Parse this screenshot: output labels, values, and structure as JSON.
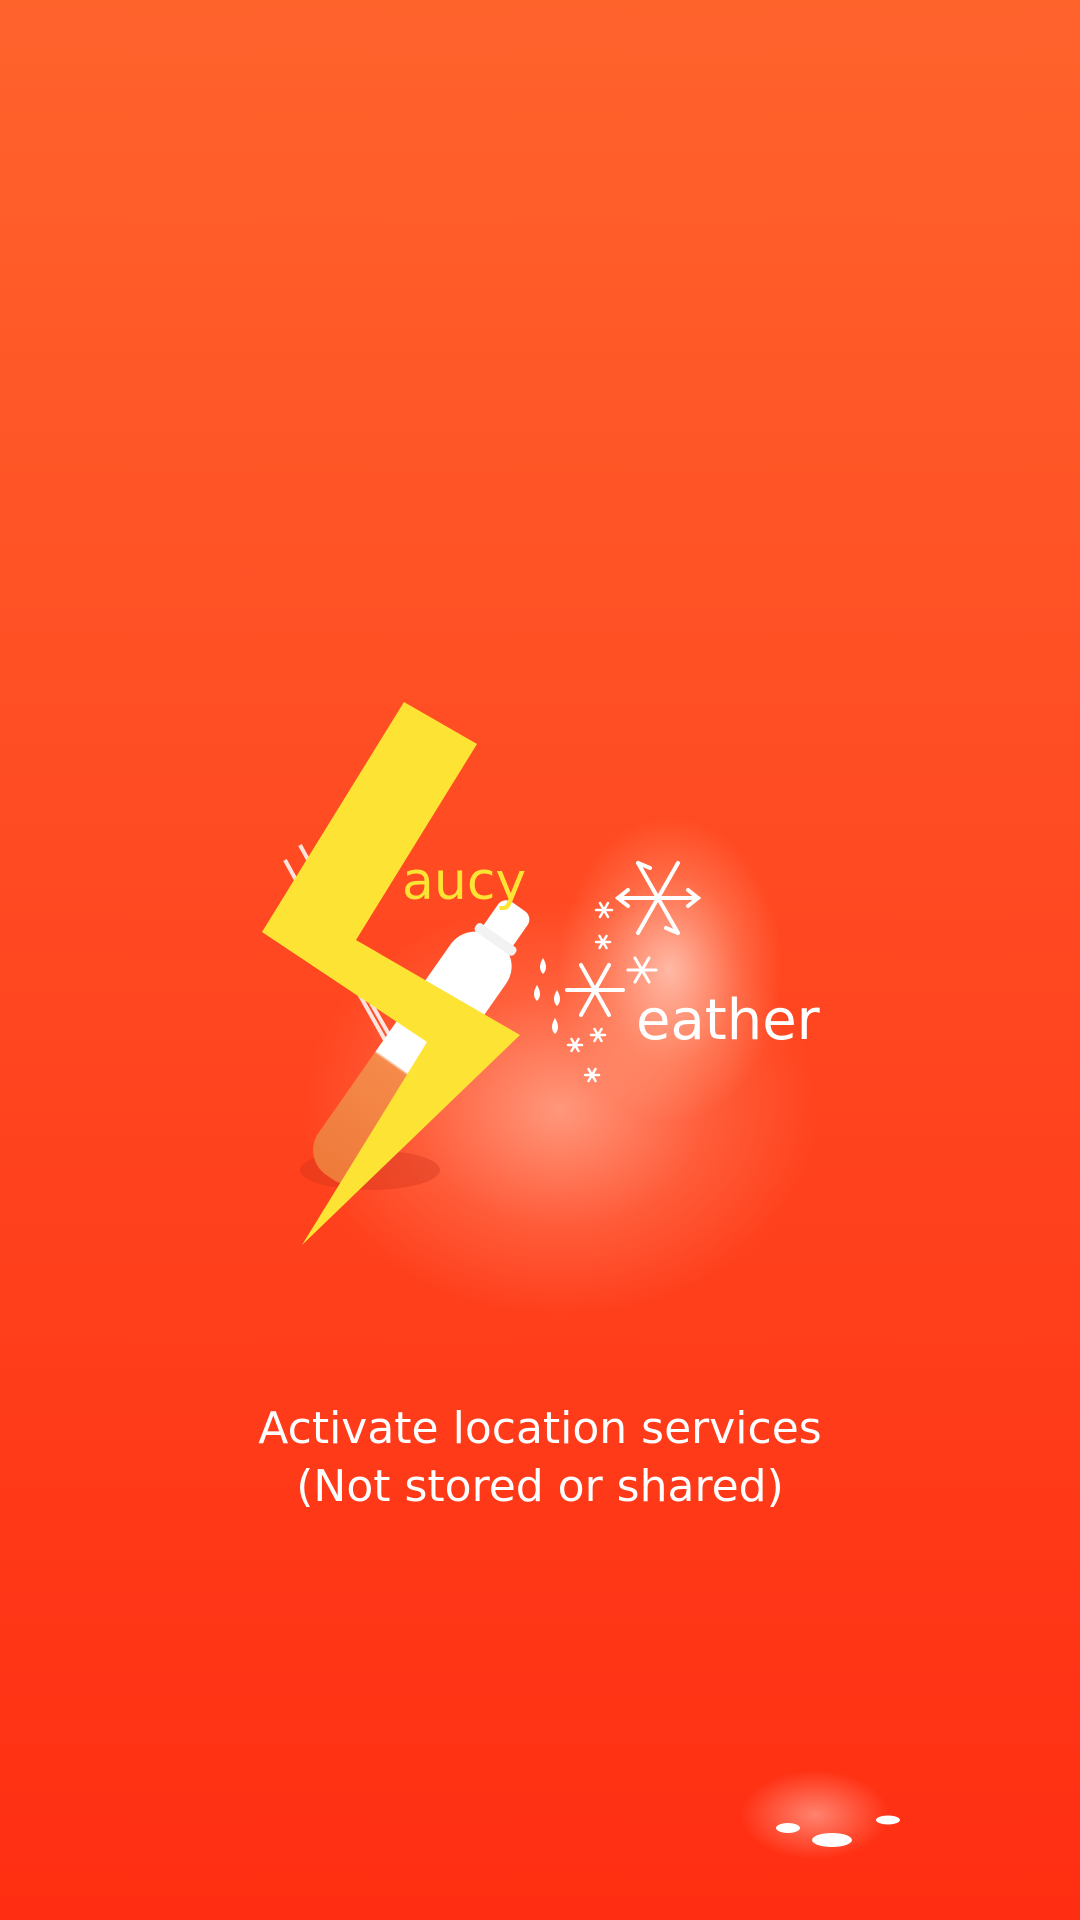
{
  "app": {
    "name_part_1": "aucy",
    "name_part_2": "eather"
  },
  "message": {
    "line1": "Activate location services",
    "line2": "(Not stored or shared)"
  },
  "icons": {
    "bolt": "lightning-bolt-icon",
    "bottle": "sauce-bottle-icon",
    "snow": "snowflake-icon",
    "loader": "loading-dots-icon"
  },
  "colors": {
    "background_top": "#ff632c",
    "background_bottom": "#ff2e12",
    "bolt": "#fde334",
    "text": "#ffffff"
  }
}
